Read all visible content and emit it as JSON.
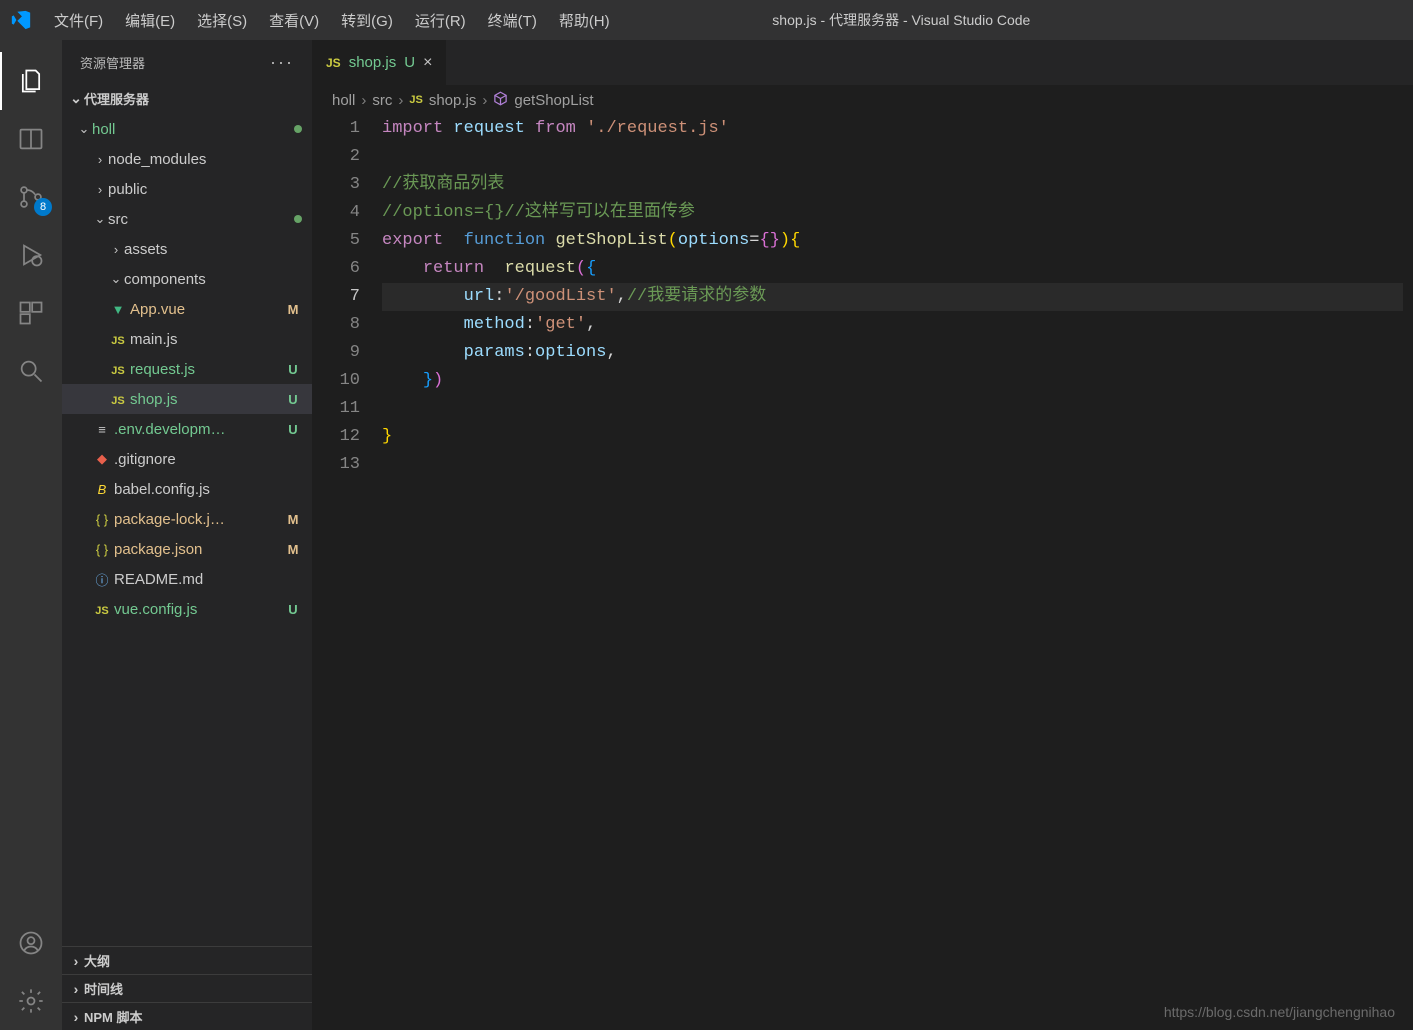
{
  "window": {
    "title": "shop.js - 代理服务器 - Visual Studio Code"
  },
  "menu": [
    "文件(F)",
    "编辑(E)",
    "选择(S)",
    "查看(V)",
    "转到(G)",
    "运行(R)",
    "终端(T)",
    "帮助(H)"
  ],
  "activity": {
    "scm_badge": "8"
  },
  "sidebar": {
    "title": "资源管理器",
    "project": "代理服务器",
    "root": "holl",
    "nodes": [
      {
        "depth": 1,
        "chev": "right",
        "label": "node_modules",
        "cls": "folder-name"
      },
      {
        "depth": 1,
        "chev": "right",
        "label": "public",
        "cls": "folder-name"
      },
      {
        "depth": 1,
        "chev": "down",
        "label": "src",
        "cls": "folder-name",
        "dot": true
      },
      {
        "depth": 2,
        "chev": "right",
        "label": "assets",
        "cls": "folder-name"
      },
      {
        "depth": 2,
        "chev": "down",
        "label": "components",
        "cls": "folder-name"
      },
      {
        "depth": 2,
        "icon": "vue",
        "label": "App.vue",
        "git": "M",
        "gcls": "git-mod"
      },
      {
        "depth": 2,
        "icon": "js",
        "label": "main.js"
      },
      {
        "depth": 2,
        "icon": "js",
        "label": "request.js",
        "git": "U",
        "gcls": "git-unt"
      },
      {
        "depth": 2,
        "icon": "js",
        "label": "shop.js",
        "git": "U",
        "gcls": "git-unt",
        "selected": true
      },
      {
        "depth": 1,
        "icon": "txt",
        "label": ".env.developm…",
        "git": "U",
        "gcls": "git-unt"
      },
      {
        "depth": 1,
        "icon": "git",
        "label": ".gitignore"
      },
      {
        "depth": 1,
        "icon": "babel",
        "label": "babel.config.js"
      },
      {
        "depth": 1,
        "icon": "json",
        "label": "package-lock.j…",
        "git": "M",
        "gcls": "git-mod"
      },
      {
        "depth": 1,
        "icon": "json",
        "label": "package.json",
        "git": "M",
        "gcls": "git-mod"
      },
      {
        "depth": 1,
        "icon": "info",
        "label": "README.md"
      },
      {
        "depth": 1,
        "icon": "js",
        "label": "vue.config.js",
        "git": "U",
        "gcls": "git-unt"
      }
    ],
    "outline": "大纲",
    "timeline": "时间线",
    "npm": "NPM 脚本"
  },
  "tab": {
    "icon": "JS",
    "name": "shop.js",
    "status": "U"
  },
  "breadcrumbs": [
    "holl",
    "src",
    "shop.js",
    "getShopList"
  ],
  "code": {
    "line1": {
      "t1": "import",
      "t2": "request",
      "t3": "from",
      "t4": "'./request.js'"
    },
    "line3": "//获取商品列表",
    "line4a": "//options={}",
    "line4b": "//这样写可以在里面传参",
    "line5": {
      "exp": "export",
      "fun": "function",
      "name": "getShopList",
      "opt": "options"
    },
    "line6": {
      "ret": "return",
      "req": "request"
    },
    "line7": {
      "k": "url",
      "v": "'/goodList'",
      "c": "//我要请求的参数"
    },
    "line8": {
      "k": "method",
      "v": "'get'"
    },
    "line9": {
      "k": "params",
      "v": "options"
    }
  },
  "watermark": "https://blog.csdn.net/jiangchengnihao"
}
